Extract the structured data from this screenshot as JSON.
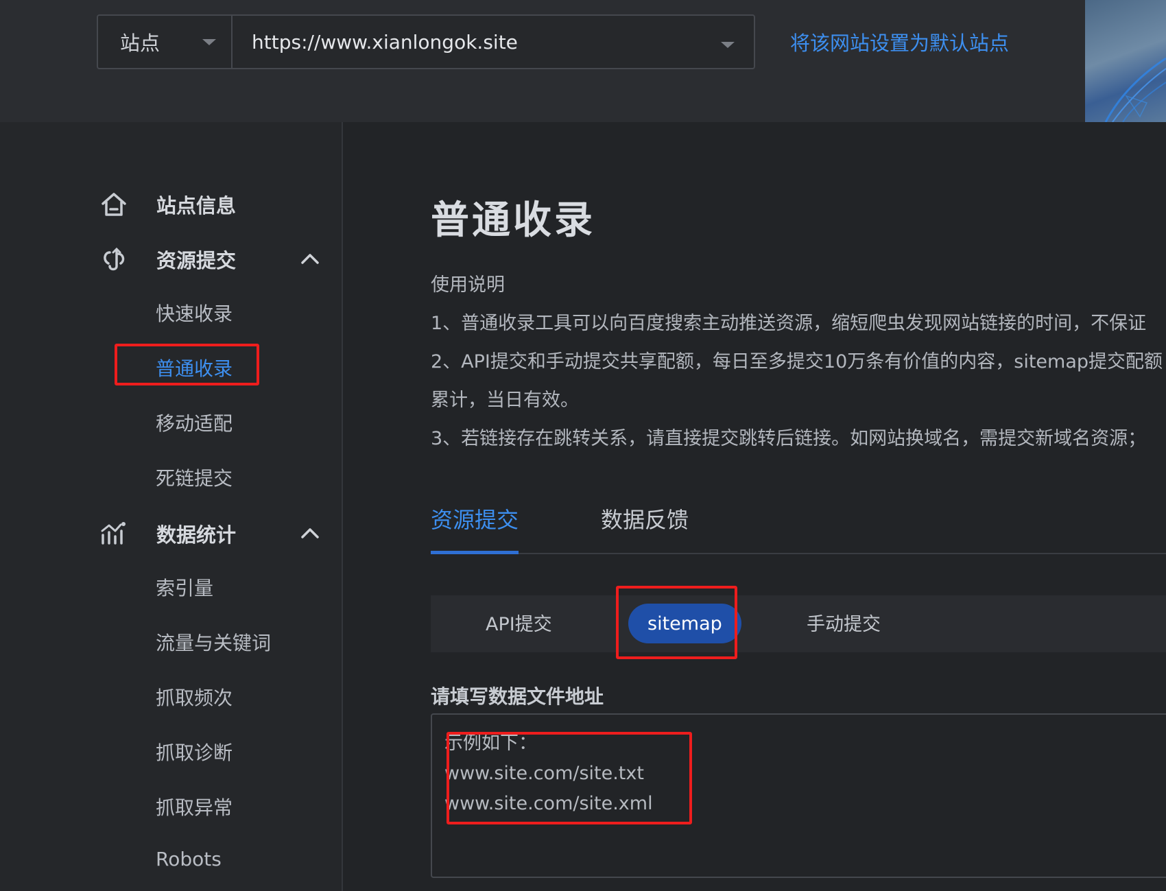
{
  "header": {
    "site_type": "站点",
    "site_url": "https://www.xianlongok.site",
    "set_default_link": "将该网站设置为默认站点"
  },
  "sidebar": {
    "groups": [
      {
        "label": "站点信息",
        "icon": "home-icon"
      },
      {
        "label": "资源提交",
        "icon": "upload-link-icon",
        "expanded": true,
        "items": [
          "快速收录",
          "普通收录",
          "移动适配",
          "死链提交"
        ]
      },
      {
        "label": "数据统计",
        "icon": "chart-icon",
        "expanded": true,
        "items": [
          "索引量",
          "流量与关键词",
          "抓取频次",
          "抓取诊断",
          "抓取异常",
          "Robots"
        ]
      }
    ],
    "active_item": "普通收录"
  },
  "main": {
    "title": "普通收录",
    "usage_title": "使用说明",
    "usage_lines": [
      "1、普通收录工具可以向百度搜索主动推送资源，缩短爬虫发现网站链接的时间，不保证",
      "2、API提交和手动提交共享配额，每日至多提交10万条有价值的内容，sitemap提交配额",
      "累计，当日有效。",
      "3、若链接存在跳转关系，请直接提交跳转后链接。如网站换域名，需提交新域名资源；"
    ],
    "tabs": [
      {
        "label": "资源提交",
        "active": true
      },
      {
        "label": "数据反馈",
        "active": false
      }
    ],
    "subtabs": [
      {
        "label": "API提交",
        "active": false
      },
      {
        "label": "sitemap",
        "active": true
      },
      {
        "label": "手动提交",
        "active": false
      }
    ],
    "field_label": "请填写数据文件地址",
    "textarea_placeholder_lines": [
      "示例如下：",
      "www.site.com/site.txt",
      "www.site.com/site.xml"
    ]
  },
  "colors": {
    "accent": "#3d8ff0",
    "active_pill": "#1f4fa8",
    "highlight": "#ee1d1d",
    "background": "#222427"
  }
}
